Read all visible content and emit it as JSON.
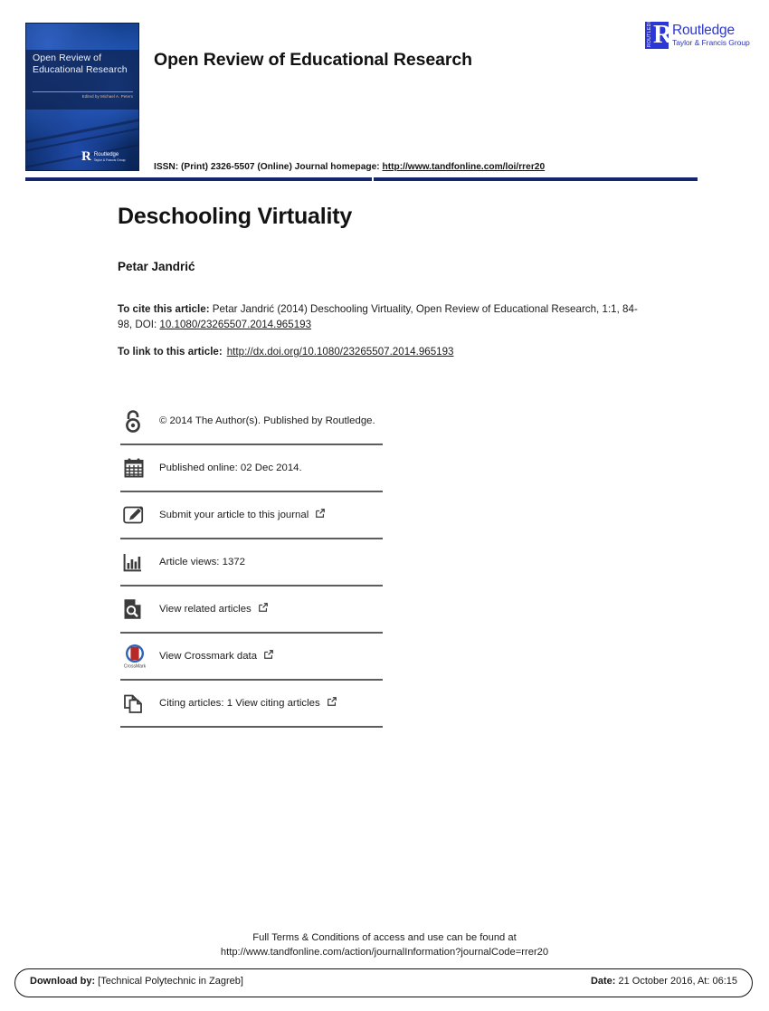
{
  "header": {
    "journal_title": "Open Review of Educational Research",
    "issn_prefix": "ISSN: (Print) 2326-5507 (Online) Journal homepage:",
    "homepage_url": "http://www.tandfonline.com/loi/rrer20",
    "cover": {
      "title": "Open Review of Educational Research",
      "editor": "Edited by Michael A. Peters",
      "publisher_initial": "R",
      "publisher_name": "Routledge",
      "publisher_sub": "Taylor & Francis Group"
    },
    "publisher_logo": {
      "vertical_text": "ROUTLEDGE",
      "initial": "R",
      "name": "Routledge",
      "sub": "Taylor & Francis Group",
      "color": "#2b36d4"
    },
    "rule_color": "#15256e"
  },
  "article": {
    "title": "Deschooling Virtuality",
    "author": "Petar Jandrić",
    "cite_label": "To cite this article:",
    "cite_text": " Petar Jandrić (2014) Deschooling Virtuality, Open Review of Educational Research, 1:1, 84-98, DOI: ",
    "cite_doi": "10.1080/23265507.2014.965193",
    "link_label": "To link to this article:",
    "link_url": "http://dx.doi.org/10.1080/23265507.2014.965193"
  },
  "meta": {
    "rows": [
      {
        "icon": "open-access-icon",
        "label": "© 2014 The Author(s). Published by Routledge.",
        "external": false
      },
      {
        "icon": "calendar-icon",
        "label": "Published online: 02 Dec 2014.",
        "external": false
      },
      {
        "icon": "submit-article-icon",
        "label": "Submit your article to this journal",
        "external": true
      },
      {
        "icon": "article-views-icon",
        "label": "Article views: 1372",
        "external": false
      },
      {
        "icon": "view-related-articles-icon",
        "label": "View related articles",
        "external": true
      },
      {
        "icon": "crossmark-icon",
        "label": "View Crossmark data",
        "external": true
      },
      {
        "icon": "citing-articles-icon",
        "label": "Citing articles: 1 View citing articles",
        "external": true
      }
    ],
    "crossmark_caption": "CrossMark"
  },
  "footer": {
    "terms_line1": "Full Terms & Conditions of access and use can be found at",
    "terms_line2": "http://www.tandfonline.com/action/journalInformation?journalCode=rrer20",
    "download_label": "Download by:",
    "download_value": " [Technical Polytechnic in Zagreb]",
    "date_label": "Date:",
    "date_value": " 21 October 2016, At: 06:15"
  }
}
